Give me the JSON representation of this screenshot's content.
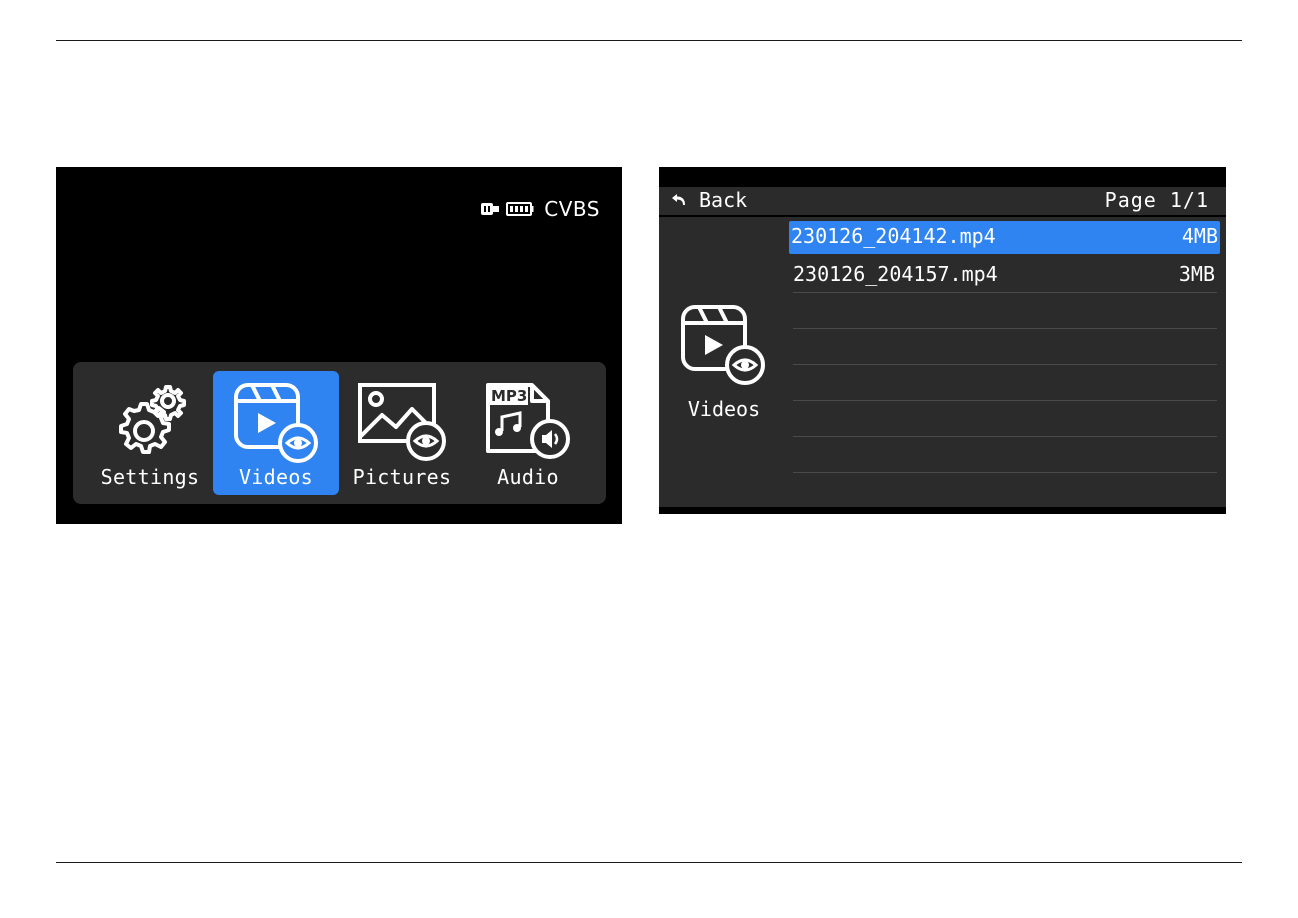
{
  "home_screen": {
    "status": {
      "icons": [
        "usb-icon",
        "battery-icon"
      ],
      "output_mode": "CVBS"
    },
    "menu": [
      {
        "label": "Settings",
        "icon": "gears-icon",
        "selected": false
      },
      {
        "label": "Videos",
        "icon": "video-view-icon",
        "selected": true
      },
      {
        "label": "Pictures",
        "icon": "picture-view-icon",
        "selected": false
      },
      {
        "label": "Audio",
        "icon": "mp3-audio-icon",
        "selected": false
      }
    ],
    "mp3_tag": "MP3"
  },
  "files_screen": {
    "back_label": "Back",
    "page_label": "Page 1/1",
    "folder_label": "Videos",
    "files": [
      {
        "name": "230126_204142.mp4",
        "size": "4MB",
        "selected": true
      },
      {
        "name": "230126_204157.mp4",
        "size": "3MB",
        "selected": false
      }
    ],
    "empty_rows": 5
  },
  "colors": {
    "selection": "#2f84f1",
    "panel": "#2b2b2b",
    "screen": "#000000",
    "text": "#ffffff"
  }
}
